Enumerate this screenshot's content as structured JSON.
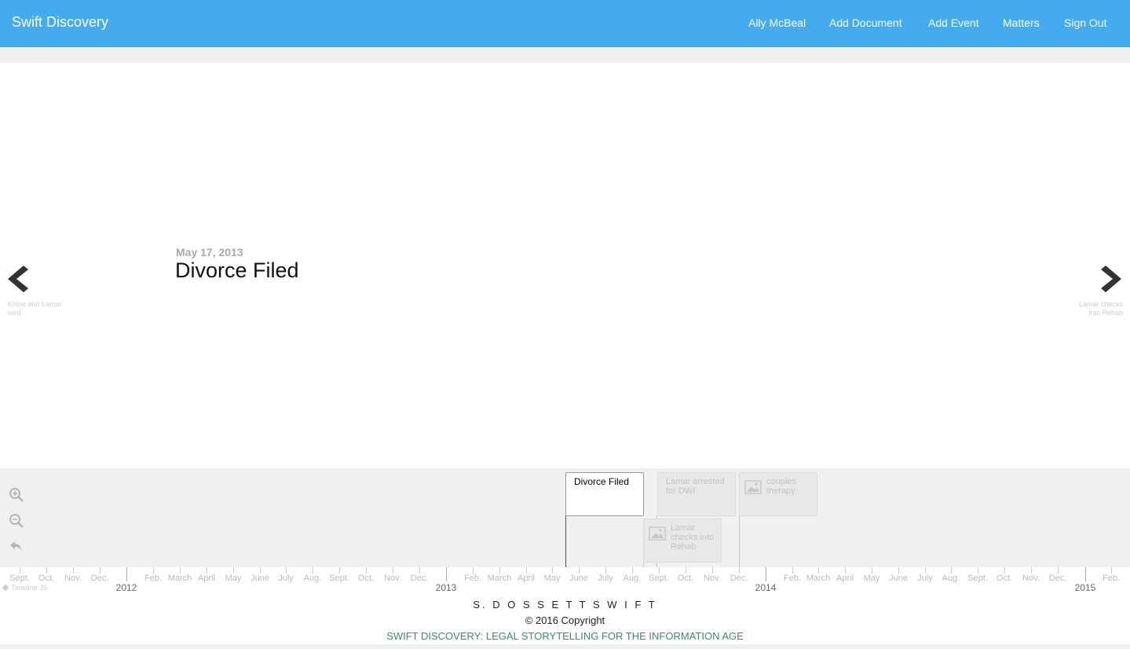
{
  "navbar": {
    "brand": "Swift Discovery",
    "links": [
      "Ally McBeal",
      "Add Document",
      "Add Event",
      "Matters",
      "Sign Out"
    ],
    "color": "#44acee"
  },
  "slide": {
    "date": "May 17, 2013",
    "title": "Divorce Filed",
    "prev_caption": "Khloe and Lamar wed",
    "next_caption": "Lamar checks into Rehab"
  },
  "navigator": {
    "controls": [
      "zoom-in-icon",
      "zoom-out-icon",
      "back-to-start-icon"
    ],
    "markers": [
      {
        "label": "Divorce Filed",
        "active": true,
        "has_image": false
      },
      {
        "label": "Lamar arrested for DWI",
        "active": false,
        "has_image": false
      },
      {
        "label": "couples therapy",
        "active": false,
        "has_image": true
      },
      {
        "label": "Lamar checks into Rehab",
        "active": false,
        "has_image": true
      }
    ]
  },
  "timeaxis": {
    "months": [
      "Sept.",
      "Oct.",
      "Nov.",
      "Dec.",
      "Feb.",
      "March",
      "April",
      "May",
      "June",
      "July",
      "Aug.",
      "Sept.",
      "Oct.",
      "Nov.",
      "Dec.",
      "Feb.",
      "March",
      "April",
      "May",
      "June",
      "July",
      "Aug.",
      "Sept.",
      "Oct.",
      "Nov.",
      "Dec.",
      "Feb.",
      "March",
      "April",
      "May",
      "June",
      "July",
      "Aug.",
      "Sept.",
      "Oct.",
      "Nov.",
      "Dec.",
      "Feb."
    ],
    "years": [
      "2012",
      "2013",
      "2014",
      "2015"
    ],
    "credit": "Timeline JS"
  },
  "footer": {
    "name": "S. D O S S E T T S W I F T",
    "copyright": "© 2016 Copyright",
    "tagline": "SWIFT DISCOVERY: LEGAL STORYTELLING FOR THE INFORMATION AGE"
  }
}
